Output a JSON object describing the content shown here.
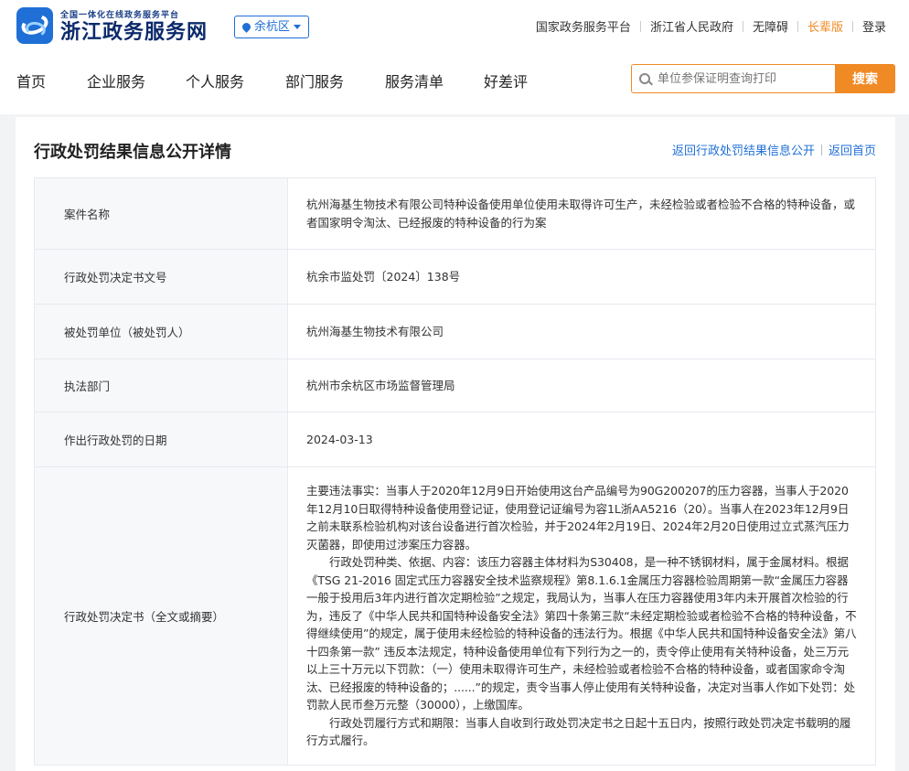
{
  "header": {
    "logo_small": "全国一体化在线政务服务平台",
    "logo_big": "浙江政务服务网",
    "region": "余杭区",
    "top_links": [
      "国家政务服务平台",
      "浙江省人民政府",
      "无障碍",
      "长辈版",
      "登录"
    ],
    "nav": [
      "首页",
      "企业服务",
      "个人服务",
      "部门服务",
      "服务清单",
      "好差评"
    ],
    "search_placeholder": "单位参保证明查询打印",
    "search_button": "搜索"
  },
  "colors": {
    "brand": "#1f6fd6",
    "accent": "#f08a24"
  },
  "page": {
    "title": "行政处罚结果信息公开详情",
    "link_back_list": "返回行政处罚结果信息公开",
    "link_back_home": "返回首页"
  },
  "rows": [
    {
      "label": "案件名称",
      "value": "杭州海基生物技术有限公司特种设备使用单位使用未取得许可生产，未经检验或者检验不合格的特种设备，或者国家明令淘汰、已经报废的特种设备的行为案"
    },
    {
      "label": "行政处罚决定书文号",
      "value": "杭余市监处罚〔2024〕138号"
    },
    {
      "label": "被处罚单位（被处罚人）",
      "value": "杭州海基生物技术有限公司"
    },
    {
      "label": "执法部门",
      "value": "杭州市余杭区市场监督管理局"
    },
    {
      "label": "作出行政处罚的日期",
      "value": "2024-03-13"
    },
    {
      "label": "行政处罚决定书（全文或摘要）",
      "paragraphs": [
        "主要违法事实：当事人于2020年12月9日开始使用这台产品编号为90G200207的压力容器，当事人于2020年12月10日取得特种设备使用登记证，使用登记证编号为容1L浙AA5216（20）。当事人在2023年12月9日之前未联系检验机构对该台设备进行首次检验，并于2024年2月19日、2024年2月20日使用过立式蒸汽压力灭菌器，即使用过涉案压力容器。",
        "行政处罚种类、依据、内容：该压力容器主体材料为S30408，是一种不锈钢材料，属于金属材料。根据《TSG 21-2016 固定式压力容器安全技术监察规程》第8.1.6.1金属压力容器检验周期第一款“金属压力容器一般于投用后3年内进行首次定期检验”之规定，我局认为，当事人在压力容器使用3年内未开展首次检验的行为，违反了《中华人民共和国特种设备安全法》第四十条第三款“未经定期检验或者检验不合格的特种设备，不得继续使用”的规定，属于使用未经检验的特种设备的违法行为。根据《中华人民共和国特种设备安全法》第八十四条第一款” 违反本法规定，特种设备使用单位有下列行为之一的，责令停止使用有关特种设备，处三万元以上三十万元以下罚款：（一）使用未取得许可生产，未经检验或者检验不合格的特种设备，或者国家命令淘汰、已经报废的特种设备的；......”的规定，责令当事人停止使用有关特种设备，决定对当事人作如下处罚：处罚款人民币叁万元整（30000），上缴国库。",
        "行政处罚履行方式和期限：当事人自收到行政处罚决定书之日起十五日内，按照行政处罚决定书载明的履行方式履行。"
      ]
    }
  ]
}
